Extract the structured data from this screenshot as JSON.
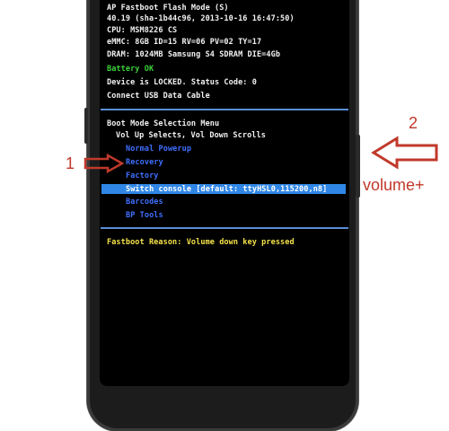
{
  "header": {
    "mode_line": "AP Fastboot Flash Mode (S)",
    "version_line": "40.19 (sha-1b44c96, 2013-10-16 16:47:50)",
    "cpu_line": "CPU: MSM8226 CS",
    "emmc_line": "eMMC: 8GB ID=15 RV=06 PV=02 TY=17",
    "dram_line": "DRAM: 1024MB Samsung S4 SDRAM DIE=4Gb",
    "battery_line": "Battery OK",
    "lock_line": "Device is LOCKED.  Status Code: 0",
    "usb_line": "Connect USB Data Cable"
  },
  "menu": {
    "title": "Boot Mode Selection Menu",
    "hint": "Vol Up Selects, Vol Down Scrolls",
    "items": [
      "Normal Powerup",
      "Recovery",
      "Factory",
      "Switch console [default: ttyHSL0,115200,n8]",
      "Barcodes",
      "BP Tools"
    ]
  },
  "footer": {
    "reason_line": "Fastboot Reason: Volume down key pressed"
  },
  "annotations": {
    "left_number": "1",
    "right_number": "2",
    "right_label": "volume+",
    "color": "#c0392b"
  }
}
